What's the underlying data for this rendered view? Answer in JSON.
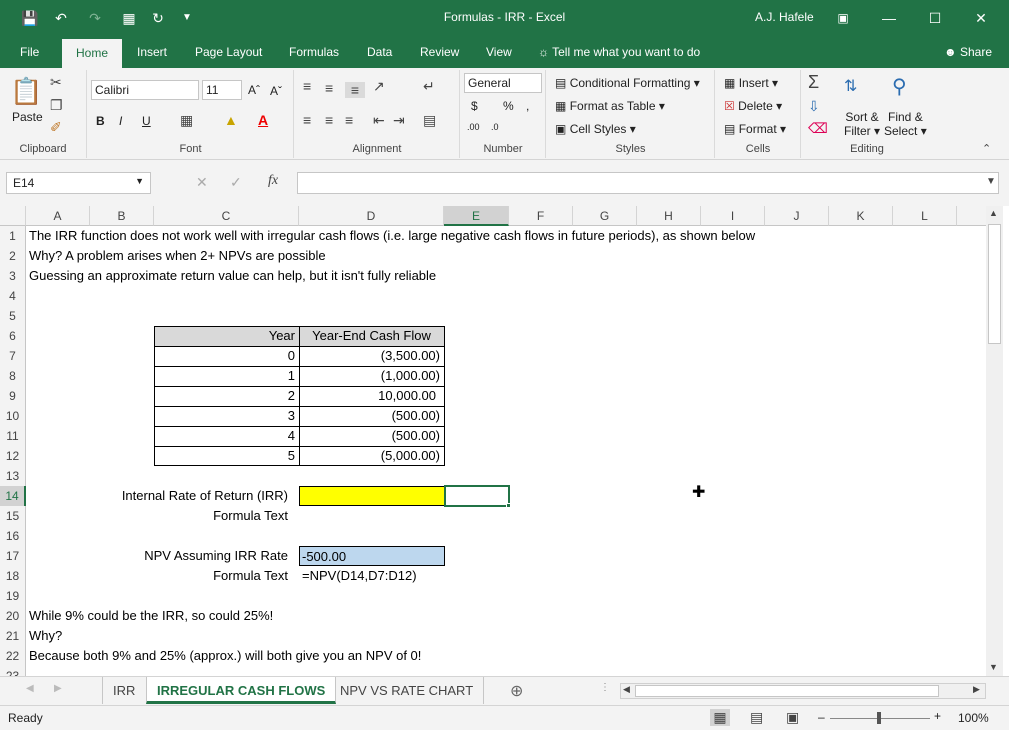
{
  "window": {
    "title": "Formulas - IRR  -  Excel",
    "user": "A.J. Hafele",
    "colors": {
      "brand": "#217346"
    }
  },
  "ribbon": {
    "tabs": [
      "File",
      "Home",
      "Insert",
      "Page Layout",
      "Formulas",
      "Data",
      "Review",
      "View"
    ],
    "tell_me": "Tell me what you want to do",
    "share": "Share",
    "clipboard": {
      "label": "Clipboard",
      "paste": "Paste"
    },
    "font": {
      "label": "Font",
      "name": "Calibri",
      "size": "11"
    },
    "alignment": {
      "label": "Alignment"
    },
    "number": {
      "label": "Number",
      "format": "General"
    },
    "styles": {
      "label": "Styles",
      "cond": "Conditional Formatting",
      "table": "Format as Table",
      "cell": "Cell Styles"
    },
    "cells": {
      "label": "Cells",
      "insert": "Insert",
      "delete": "Delete",
      "format": "Format"
    },
    "editing": {
      "label": "Editing",
      "sort1": "Sort &",
      "sort2": "Filter",
      "find1": "Find &",
      "find2": "Select"
    }
  },
  "formula_bar": {
    "name_box": "E14",
    "content": ""
  },
  "grid": {
    "columns": [
      "A",
      "B",
      "C",
      "D",
      "E",
      "F",
      "G",
      "H",
      "I",
      "J",
      "K",
      "L"
    ],
    "rows": [
      "1",
      "2",
      "3",
      "4",
      "5",
      "6",
      "7",
      "8",
      "9",
      "10",
      "11",
      "12",
      "13",
      "14",
      "15",
      "16",
      "17",
      "18",
      "19",
      "20",
      "21",
      "22",
      "23"
    ],
    "text": {
      "a1": "The IRR function does not work well with irregular cash flows (i.e. large negative cash flows in future periods), as shown below",
      "a2": "Why?  A problem arises when 2+ NPVs are possible",
      "a3": "Guessing an approximate return value can help, but it isn't fully reliable",
      "a20": "While 9% could be the IRR, so could 25%!",
      "a21": "Why?",
      "a22": "Because both 9% and 25% (approx.) will both give you an NPV of 0!"
    },
    "table": {
      "header_year": "Year",
      "header_cf": "Year-End Cash Flow",
      "rows": [
        {
          "year": "0",
          "cf": "(3,500.00)"
        },
        {
          "year": "1",
          "cf": "(1,000.00)"
        },
        {
          "year": "2",
          "cf": "10,000.00"
        },
        {
          "year": "3",
          "cf": "(500.00)"
        },
        {
          "year": "4",
          "cf": "(500.00)"
        },
        {
          "year": "5",
          "cf": "(5,000.00)"
        }
      ]
    },
    "labels": {
      "irr": "Internal Rate of Return (IRR)",
      "ftext1": "Formula Text",
      "npv": "NPV Assuming IRR Rate",
      "ftext2": "Formula Text"
    },
    "values": {
      "irr": "",
      "npv": "-500.00",
      "npv_formula": "=NPV(D14,D7:D12)"
    },
    "fills": {
      "irr": "#ffff00",
      "npv": "#bdd7ee"
    }
  },
  "sheets": {
    "tabs": [
      "IRR",
      "IRREGULAR CASH FLOWS",
      "NPV VS RATE CHART"
    ],
    "active": "IRREGULAR CASH FLOWS"
  },
  "status": {
    "ready": "Ready",
    "zoom": "100%",
    "zoom_fraction": 0.5
  }
}
